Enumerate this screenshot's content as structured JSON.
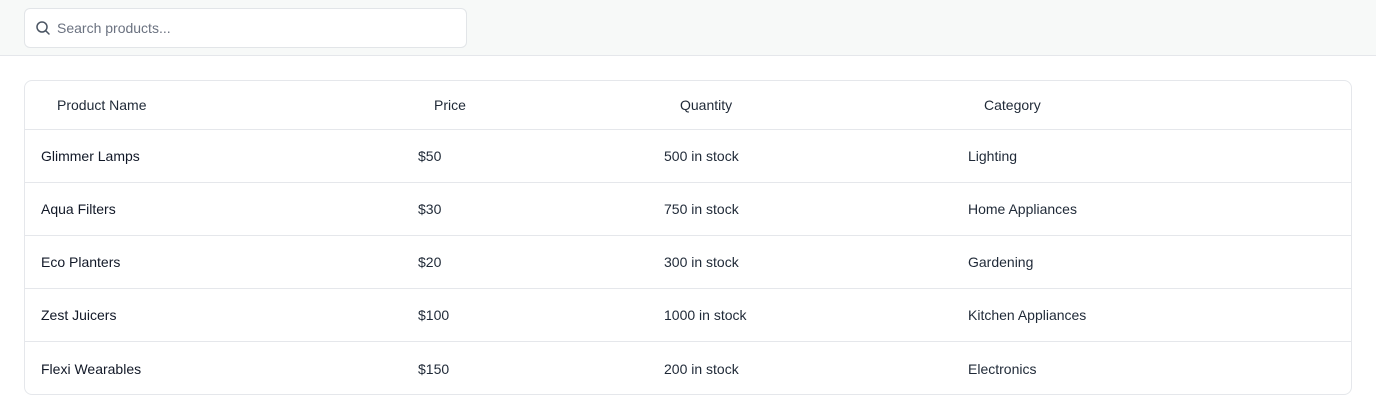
{
  "search": {
    "placeholder": "Search products...",
    "value": ""
  },
  "table": {
    "columns": [
      "Product Name",
      "Price",
      "Quantity",
      "Category"
    ],
    "rows": [
      {
        "name": "Glimmer Lamps",
        "price": "$50",
        "quantity": "500 in stock",
        "category": "Lighting"
      },
      {
        "name": "Aqua Filters",
        "price": "$30",
        "quantity": "750 in stock",
        "category": "Home Appliances"
      },
      {
        "name": "Eco Planters",
        "price": "$20",
        "quantity": "300 in stock",
        "category": "Gardening"
      },
      {
        "name": "Zest Juicers",
        "price": "$100",
        "quantity": "1000 in stock",
        "category": "Kitchen Appliances"
      },
      {
        "name": "Flexi Wearables",
        "price": "$150",
        "quantity": "200 in stock",
        "category": "Electronics"
      }
    ]
  }
}
